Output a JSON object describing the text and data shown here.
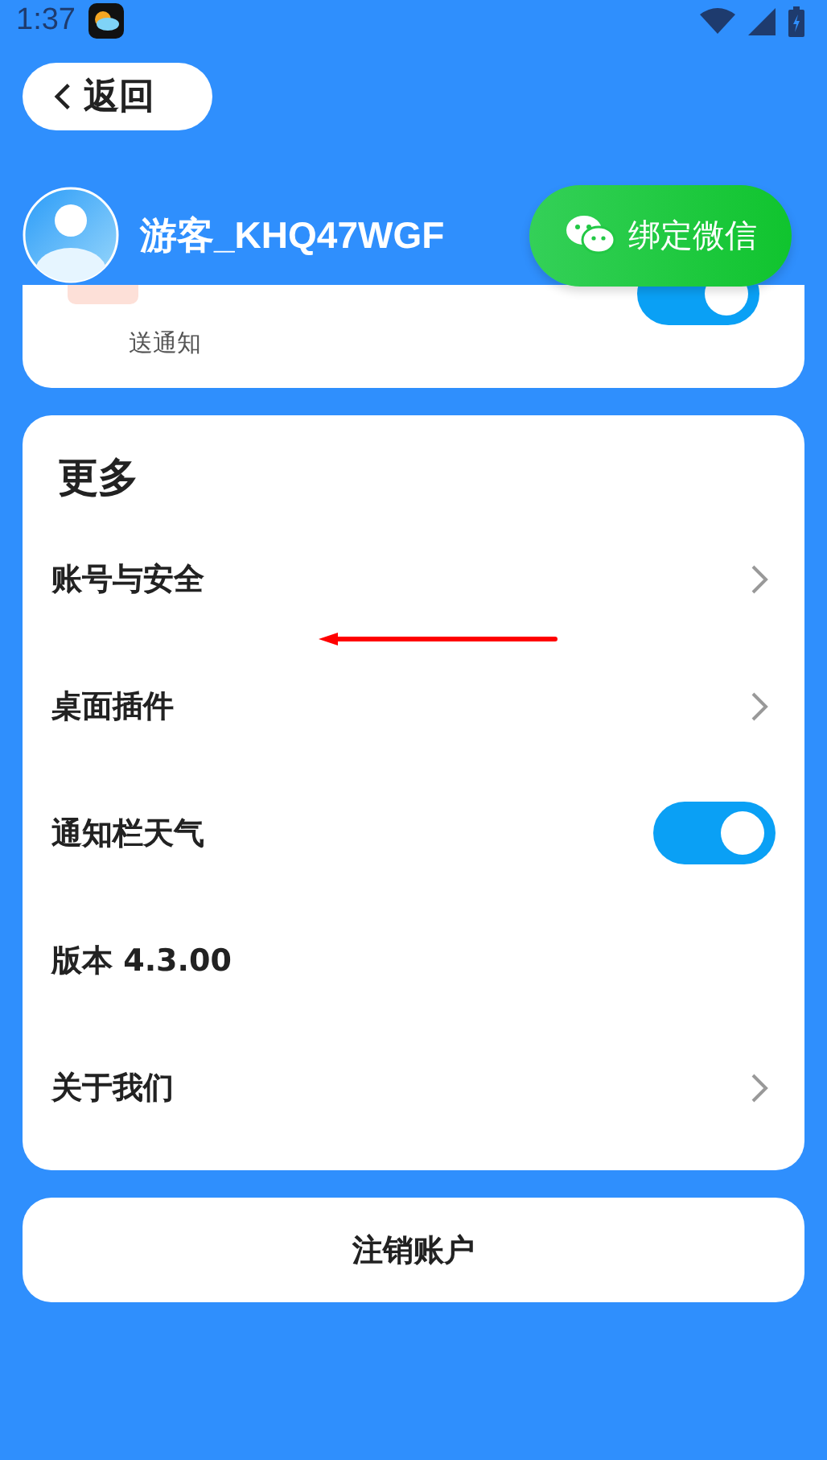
{
  "status_bar": {
    "time": "1:37"
  },
  "back_button": {
    "label": "返回"
  },
  "profile": {
    "name": "游客_KHQ47WGF",
    "bind_button": "绑定微信"
  },
  "alert_card": {
    "description_tail": "送通知",
    "toggle_on": true
  },
  "more_section": {
    "title": "更多",
    "items": [
      {
        "kind": "link",
        "label": "账号与安全"
      },
      {
        "kind": "link",
        "label": "桌面插件"
      },
      {
        "kind": "toggle",
        "label": "通知栏天气",
        "on": true
      },
      {
        "kind": "text",
        "label": "版本 4.3.00"
      },
      {
        "kind": "link",
        "label": "关于我们"
      }
    ]
  },
  "cancel_button": {
    "label": "注销账户"
  }
}
